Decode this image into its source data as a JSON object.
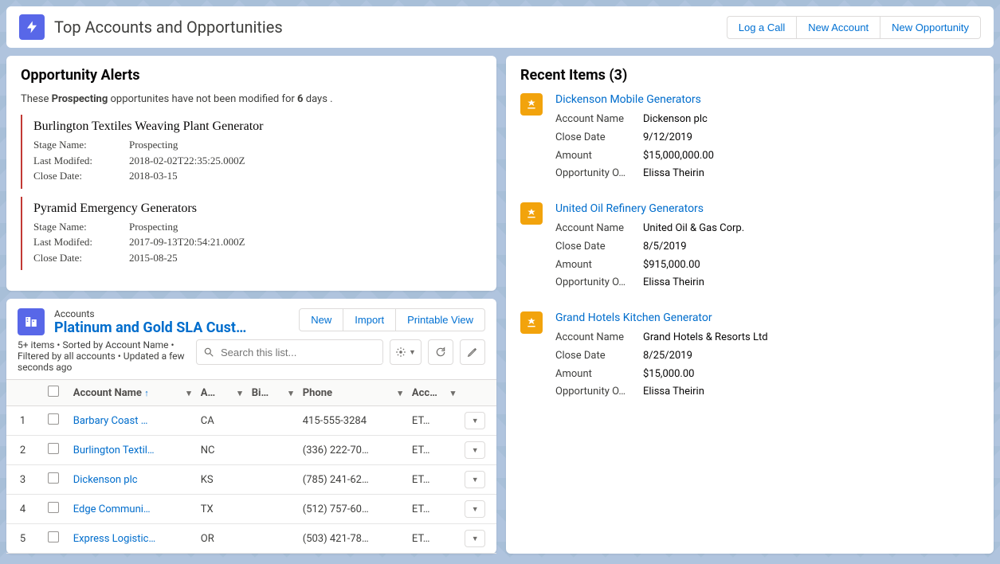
{
  "header": {
    "title": "Top Accounts and Opportunities",
    "buttons": {
      "logCall": "Log a Call",
      "newAccount": "New Account",
      "newOpportunity": "New Opportunity"
    }
  },
  "alerts": {
    "title": "Opportunity Alerts",
    "intro_prefix": "These ",
    "intro_stage": "Prospecting",
    "intro_mid": " opportunites have not been modified for ",
    "intro_days": "6",
    "intro_suffix": " days .",
    "fieldLabels": {
      "stage": "Stage Name:",
      "lastModified": "Last Modifed:",
      "closeDate": "Close Date:"
    },
    "items": [
      {
        "name": "Burlington Textiles Weaving Plant Generator",
        "stage": "Prospecting",
        "lastModified": "2018-02-02T22:35:25.000Z",
        "closeDate": "2018-03-15"
      },
      {
        "name": "Pyramid Emergency Generators",
        "stage": "Prospecting",
        "lastModified": "2017-09-13T20:54:21.000Z",
        "closeDate": "2015-08-25"
      }
    ]
  },
  "listview": {
    "objectName": "Accounts",
    "viewName": "Platinum and Gold SLA Cust…",
    "buttons": {
      "new": "New",
      "import": "Import",
      "printable": "Printable View"
    },
    "meta": "5+ items • Sorted by Account Name • Filtered by all accounts • Updated a few seconds ago",
    "searchPlaceholder": "Search this list...",
    "columns": {
      "accountName": "Account Name",
      "c2": "A…",
      "c3": "Bi…",
      "phone": "Phone",
      "c5": "Acc…"
    },
    "rows": [
      {
        "n": "1",
        "name": "Barbary Coast …",
        "state": "CA",
        "phone": "415-555-3284",
        "owner": "ET…"
      },
      {
        "n": "2",
        "name": "Burlington Textil…",
        "state": "NC",
        "phone": "(336) 222-70…",
        "owner": "ET…"
      },
      {
        "n": "3",
        "name": "Dickenson plc",
        "state": "KS",
        "phone": "(785) 241-62…",
        "owner": "ET…"
      },
      {
        "n": "4",
        "name": "Edge Communi…",
        "state": "TX",
        "phone": "(512) 757-60…",
        "owner": "ET…"
      },
      {
        "n": "5",
        "name": "Express Logistic…",
        "state": "OR",
        "phone": "(503) 421-78…",
        "owner": "ET…"
      }
    ]
  },
  "recent": {
    "title": "Recent Items (3)",
    "fieldLabels": {
      "account": "Account Name",
      "closeDate": "Close Date",
      "amount": "Amount",
      "owner": "Opportunity O…"
    },
    "items": [
      {
        "name": "Dickenson Mobile Generators",
        "account": "Dickenson plc",
        "closeDate": "9/12/2019",
        "amount": "$15,000,000.00",
        "owner": "Elissa Theirin"
      },
      {
        "name": "United Oil Refinery Generators",
        "account": "United Oil & Gas Corp.",
        "closeDate": "8/5/2019",
        "amount": "$915,000.00",
        "owner": "Elissa Theirin"
      },
      {
        "name": "Grand Hotels Kitchen Generator",
        "account": "Grand Hotels & Resorts Ltd",
        "closeDate": "8/25/2019",
        "amount": "$15,000.00",
        "owner": "Elissa Theirin"
      }
    ]
  }
}
